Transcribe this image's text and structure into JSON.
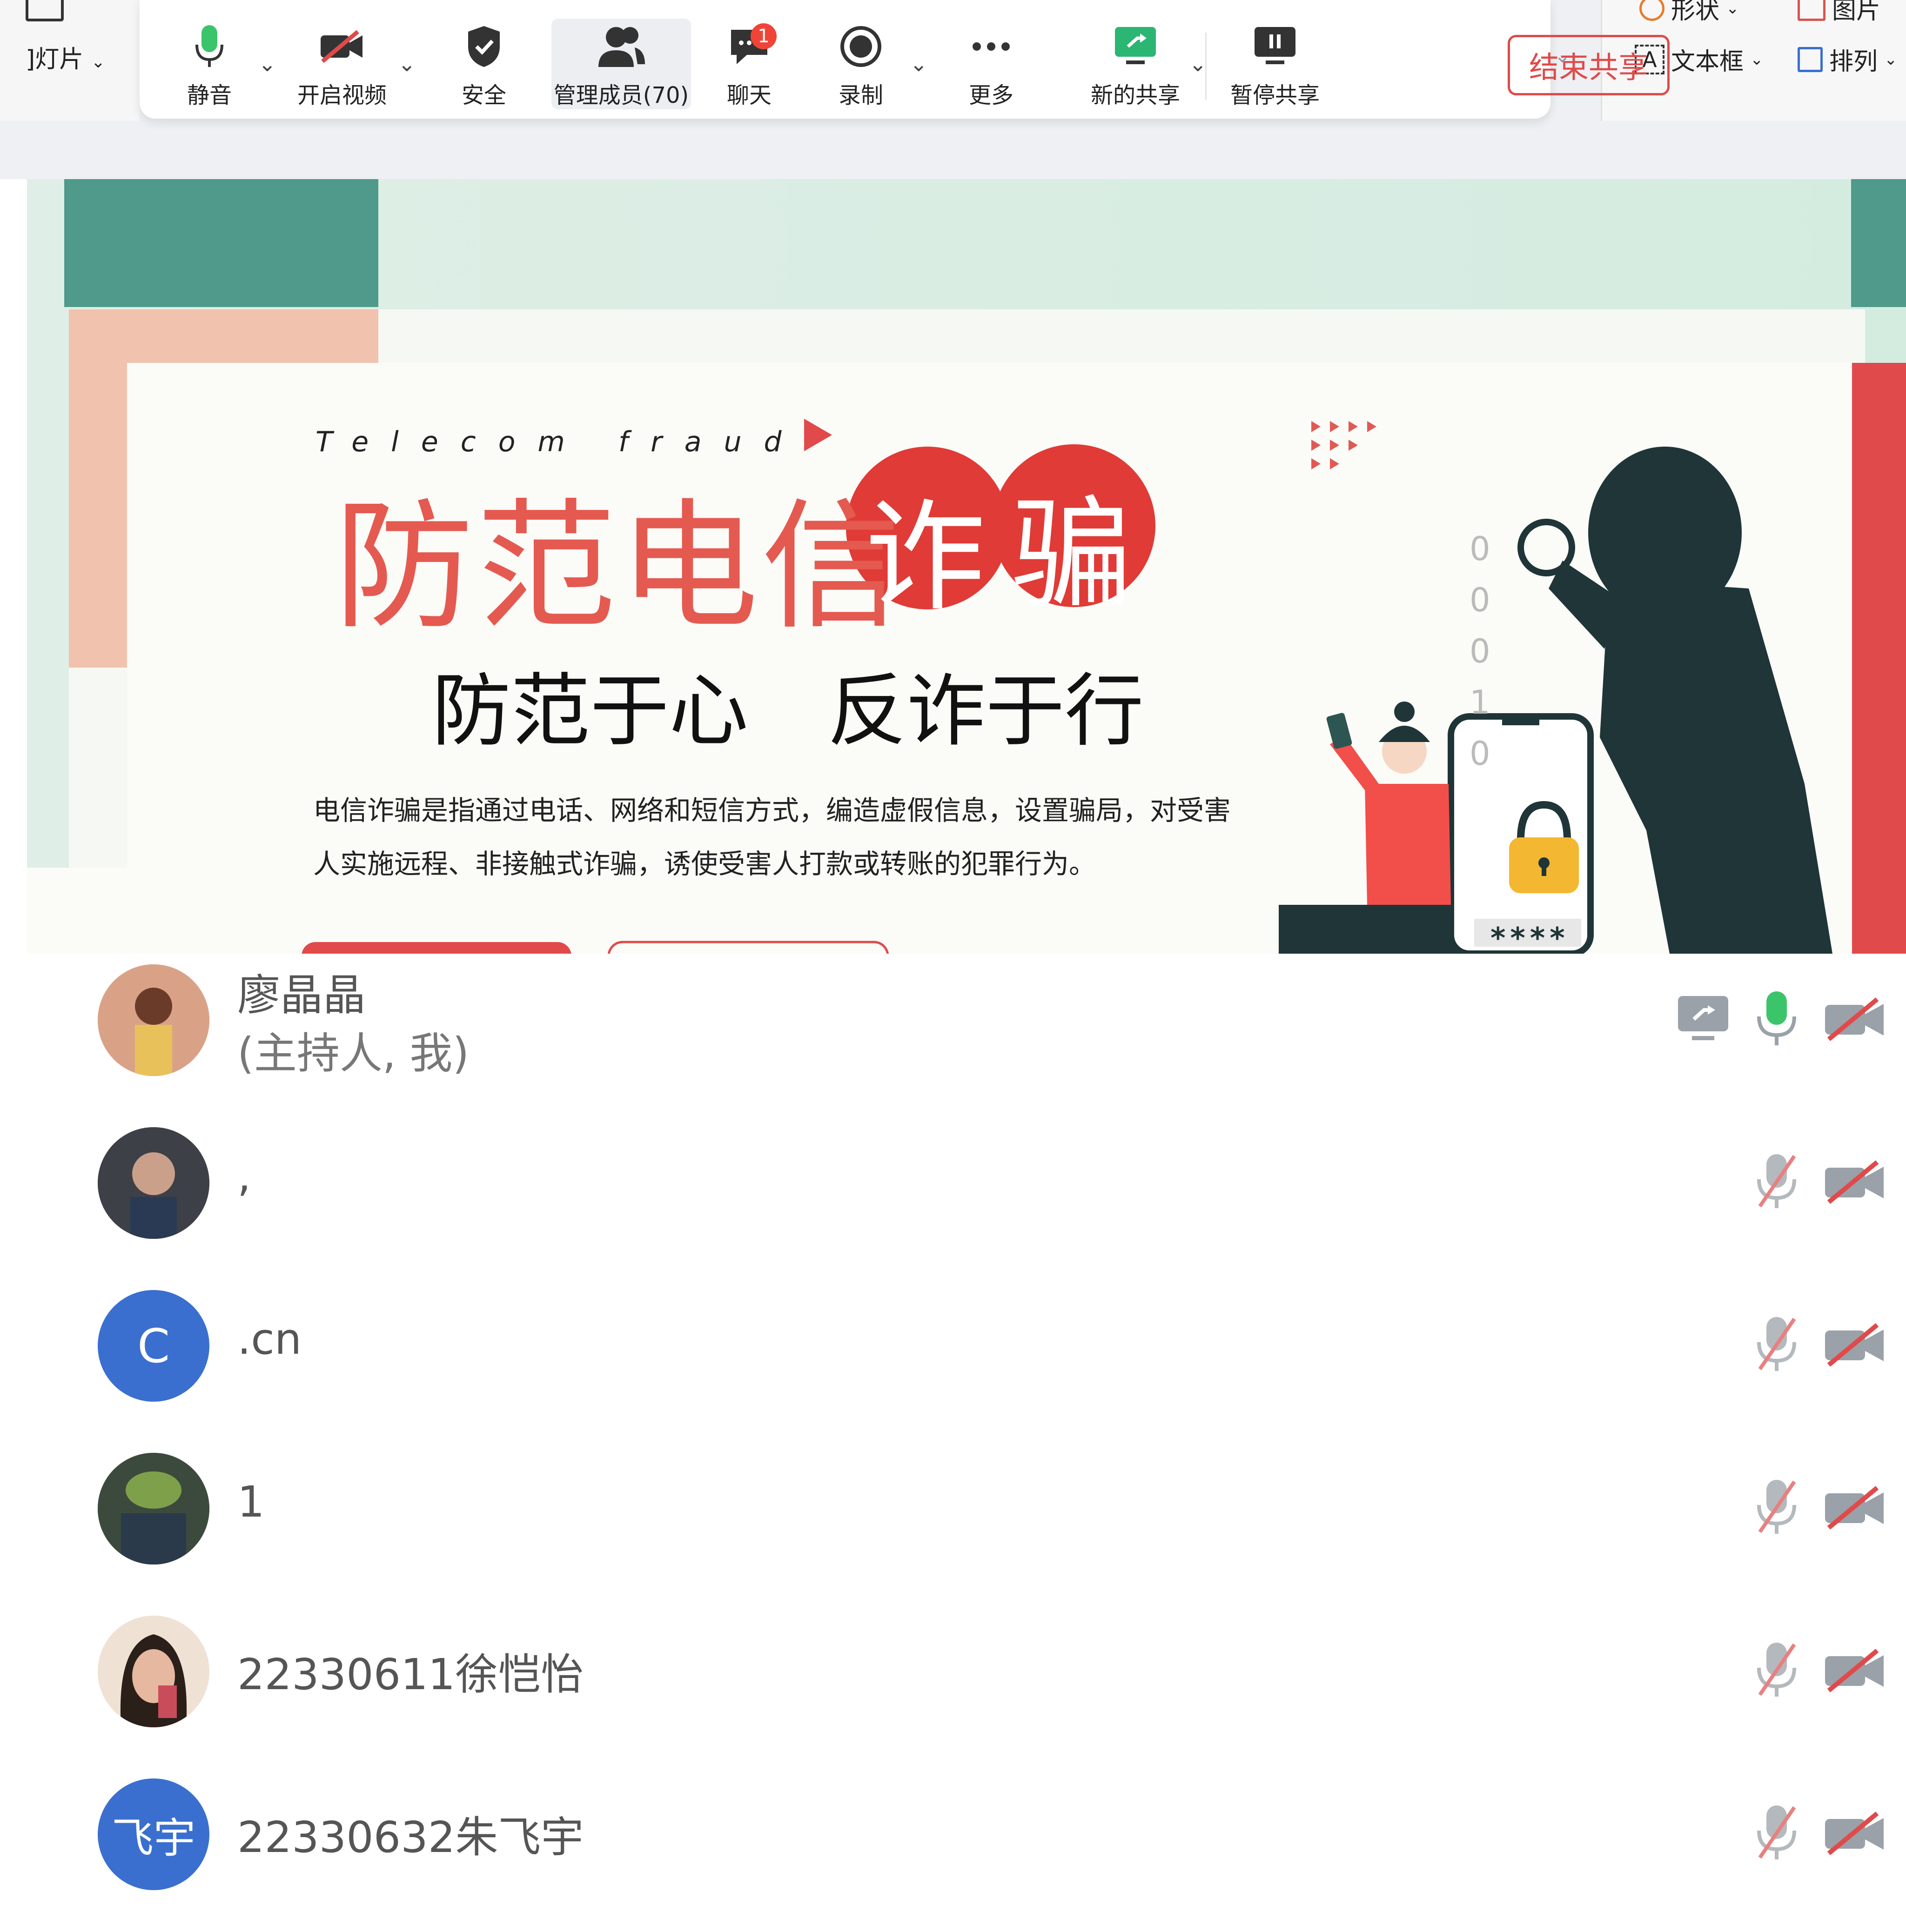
{
  "left_panel": {
    "menu_label": "]灯片"
  },
  "toolbar": {
    "mute_label": "静音",
    "video_label": "开启视频",
    "security_label": "安全",
    "members_label": "管理成员(70)",
    "chat_label": "聊天",
    "chat_badge": "1",
    "record_label": "录制",
    "more_label": "更多",
    "new_share_label": "新的共享",
    "pause_share_label": "暂停共享",
    "end_share_label": "结束共享"
  },
  "ribbon": {
    "shape_label": "形状",
    "picture_label": "图片",
    "textbox_label": "文本框",
    "arrange_label": "排列"
  },
  "slide": {
    "title_en": "Telecom fraud",
    "title_cn_main": "防范电信",
    "title_cn_circle_1": "诈",
    "title_cn_circle_2": "骗",
    "subtitle": "防范于心　反诈于行",
    "paragraph_line1": "电信诈骗是指通过电话、网络和短信方式，编造虚假信息，设置骗局，对受害",
    "paragraph_line2": "人实施远程、非接触式诈骗，诱使受害人打款或转账的犯罪行为。",
    "password_mask": "****",
    "binary_digits": "0 0 0 1 0"
  },
  "participants": [
    {
      "name": "廖晶晶",
      "role": "(主持人, 我)",
      "avatar": "photo",
      "sharing": true,
      "mic_on": true,
      "video_on": false
    },
    {
      "name": ",",
      "role": "",
      "avatar": "photo",
      "sharing": false,
      "mic_on": false,
      "video_on": false
    },
    {
      "name": ".cn",
      "role": "",
      "avatar_letter": "C",
      "avatar_color": "#3a6fcf",
      "sharing": false,
      "mic_on": false,
      "video_on": false
    },
    {
      "name": "1",
      "role": "",
      "avatar": "photo",
      "sharing": false,
      "mic_on": false,
      "video_on": false
    },
    {
      "name": "22330611徐恺怡",
      "role": "",
      "avatar": "photo",
      "sharing": false,
      "mic_on": false,
      "video_on": false
    },
    {
      "name": "22330632朱飞宇",
      "role": "",
      "avatar_letter": "飞宇",
      "avatar_color": "#3a6fcf",
      "sharing": false,
      "mic_on": false,
      "video_on": false
    }
  ],
  "colors": {
    "accent_red": "#e04a4a",
    "mic_green": "#3cc46b",
    "avatar_blue": "#3a6fcf",
    "teal": "#4f9a8a"
  }
}
